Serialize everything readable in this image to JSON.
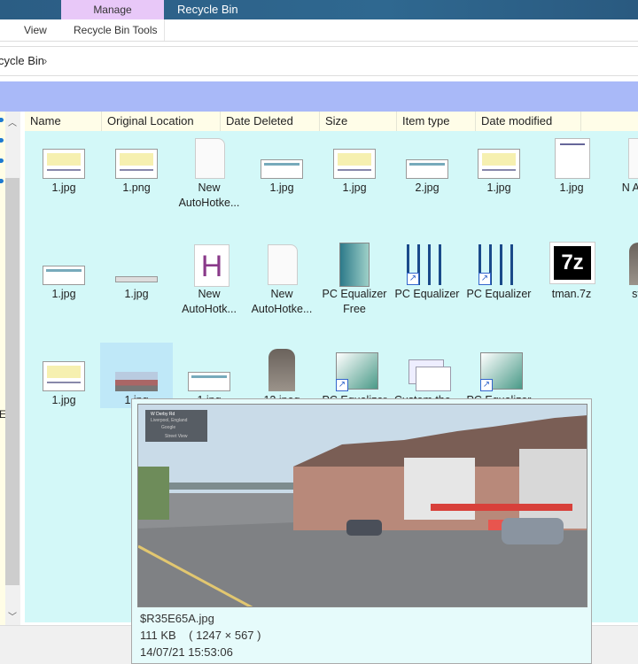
{
  "window": {
    "title": "Recycle Bin",
    "context_tab": "Manage"
  },
  "ribbon": {
    "tabs": [
      {
        "label": "View"
      },
      {
        "label": "Recycle Bin Tools"
      }
    ]
  },
  "address": {
    "breadcrumb": "cycle Bin",
    "separator": "›"
  },
  "columns": [
    "Name",
    "Original Location",
    "Date Deleted",
    "Size",
    "Item type",
    "Date modified"
  ],
  "nav": {
    "partial_letter": "E"
  },
  "items": [
    [
      {
        "label": "1.jpg",
        "icon": "screenshot-thumb"
      },
      {
        "label": "1.png",
        "icon": "screenshot-thumb"
      },
      {
        "label": "New AutoHotke...",
        "icon": "blank-file"
      },
      {
        "label": "1.jpg",
        "icon": "wide-thumb"
      },
      {
        "label": "1.jpg",
        "icon": "screenshot-thumb"
      },
      {
        "label": "2.jpg",
        "icon": "wide-thumb"
      },
      {
        "label": "1.jpg",
        "icon": "screenshot-thumb"
      },
      {
        "label": "1.jpg",
        "icon": "document-thumb"
      },
      {
        "label": "N AutoH",
        "icon": "blank-file"
      }
    ],
    [
      {
        "label": "1.jpg",
        "icon": "wide-thumb"
      },
      {
        "label": "1.jpg",
        "icon": "strip-thumb"
      },
      {
        "label": "New AutoHotk...",
        "icon": "autohotkey-h"
      },
      {
        "label": "New AutoHotke...",
        "icon": "blank-file"
      },
      {
        "label": "PC Equalizer Free",
        "icon": "installer"
      },
      {
        "label": "PC Equalizer",
        "icon": "equalizer-shortcut"
      },
      {
        "label": "PC Equalizer",
        "icon": "equalizer-shortcut"
      },
      {
        "label": "tman.7z",
        "icon": "7z-archive"
      },
      {
        "label": "ston",
        "icon": "stone-thumb"
      }
    ],
    [
      {
        "label": "1.jpg",
        "icon": "screenshot-thumb"
      },
      {
        "label": "1.jpg",
        "icon": "street-thumb",
        "selected": true
      },
      {
        "label": "1.jpg",
        "icon": "wide-thumb"
      },
      {
        "label": "12.jpeg",
        "icon": "stone-thumb"
      },
      {
        "label": "PC Equalizer",
        "icon": "app-shortcut"
      },
      {
        "label": "Custom.the...",
        "icon": "theme-pack"
      },
      {
        "label": "PC Equalizer",
        "icon": "app-shortcut"
      }
    ]
  ],
  "tooltip": {
    "name": "$R35E65A.jpg",
    "size_dims": "111 KB    ( 1247 × 567 )",
    "date": "14/07/21 15:53:06",
    "map_card": {
      "road": "W Derby Rd",
      "place": "Liverpool, England",
      "brand": "Google",
      "mode": "Street View"
    }
  },
  "colors": {
    "content_bg": "#d3f8f8",
    "band": "#a9b9f8",
    "manage_tab": "#e8c8f8",
    "titlebar": "#2b5d84"
  }
}
